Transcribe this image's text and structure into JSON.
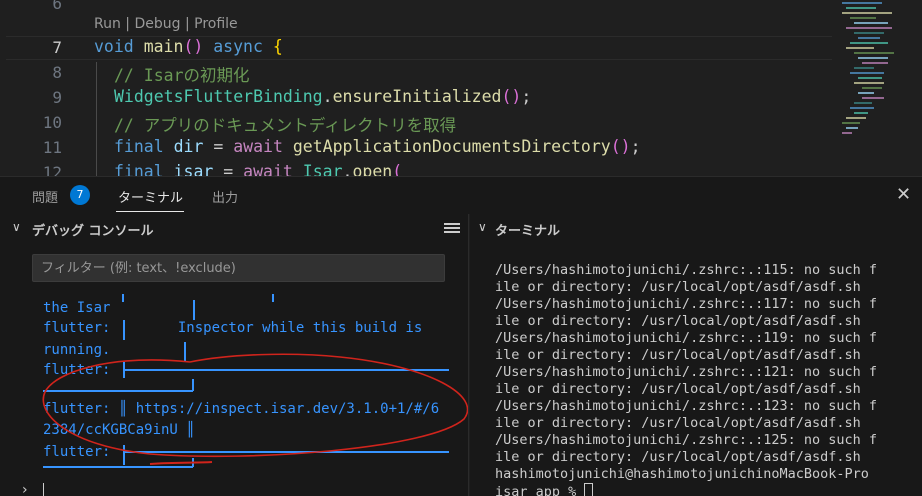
{
  "editor": {
    "line_number_top": "6",
    "codelens": "Run | Debug | Profile",
    "lines": [
      {
        "num": "7",
        "text": "void main() async {"
      },
      {
        "num": "8",
        "text": "// Isarの初期化"
      },
      {
        "num": "9",
        "text": "WidgetsFlutterBinding.ensureInitialized();"
      },
      {
        "num": "10",
        "text": "// アプリのドキュメントディレクトリを取得"
      },
      {
        "num": "11",
        "text": "final dir = await getApplicationDocumentsDirectory();"
      },
      {
        "num": "12",
        "text": "final isar = await Isar.open("
      }
    ]
  },
  "panel": {
    "tabs": [
      {
        "label": "問題",
        "badge": "7"
      },
      {
        "label": "ターミナル"
      },
      {
        "label": "出力"
      }
    ],
    "close_icon": "close-icon"
  },
  "debug_console": {
    "title": "デバッグ コンソール",
    "filter_placeholder": "フィルター (例: text、!exclude)",
    "lines": [
      "the Isar",
      "flutter:        Inspector while this build is",
      "running.",
      "flutter:",
      "flutter: ║ https://inspect.isar.dev/3.1.0+1/#/6",
      "2384/ccKGBCa9inU ║",
      "flutter:"
    ],
    "prompt": "›",
    "annotation_color": "#d0241c",
    "text_color": "#3794ff"
  },
  "terminal": {
    "title": "ターミナル",
    "lines": [
      "/Users/hashimotojunichi/.zshrc:.:115: no such f",
      "ile or directory: /usr/local/opt/asdf/asdf.sh",
      "/Users/hashimotojunichi/.zshrc:.:117: no such f",
      "ile or directory: /usr/local/opt/asdf/asdf.sh",
      "/Users/hashimotojunichi/.zshrc:.:119: no such f",
      "ile or directory: /usr/local/opt/asdf/asdf.sh",
      "/Users/hashimotojunichi/.zshrc:.:121: no such f",
      "ile or directory: /usr/local/opt/asdf/asdf.sh",
      "/Users/hashimotojunichi/.zshrc:.:123: no such f",
      "ile or directory: /usr/local/opt/asdf/asdf.sh",
      "/Users/hashimotojunichi/.zshrc:.:125: no such f",
      "ile or directory: /usr/local/opt/asdf/asdf.sh",
      "hashimotojunichi@hashimotojunichinoMacBook-Pro",
      "isar_app % "
    ]
  },
  "colors": {
    "background": "#1f1f1f",
    "panel_background": "#181818",
    "accent": "#0078d4",
    "keyword": "#569cd6",
    "function": "#dcdcaa",
    "comment": "#6a9955"
  }
}
